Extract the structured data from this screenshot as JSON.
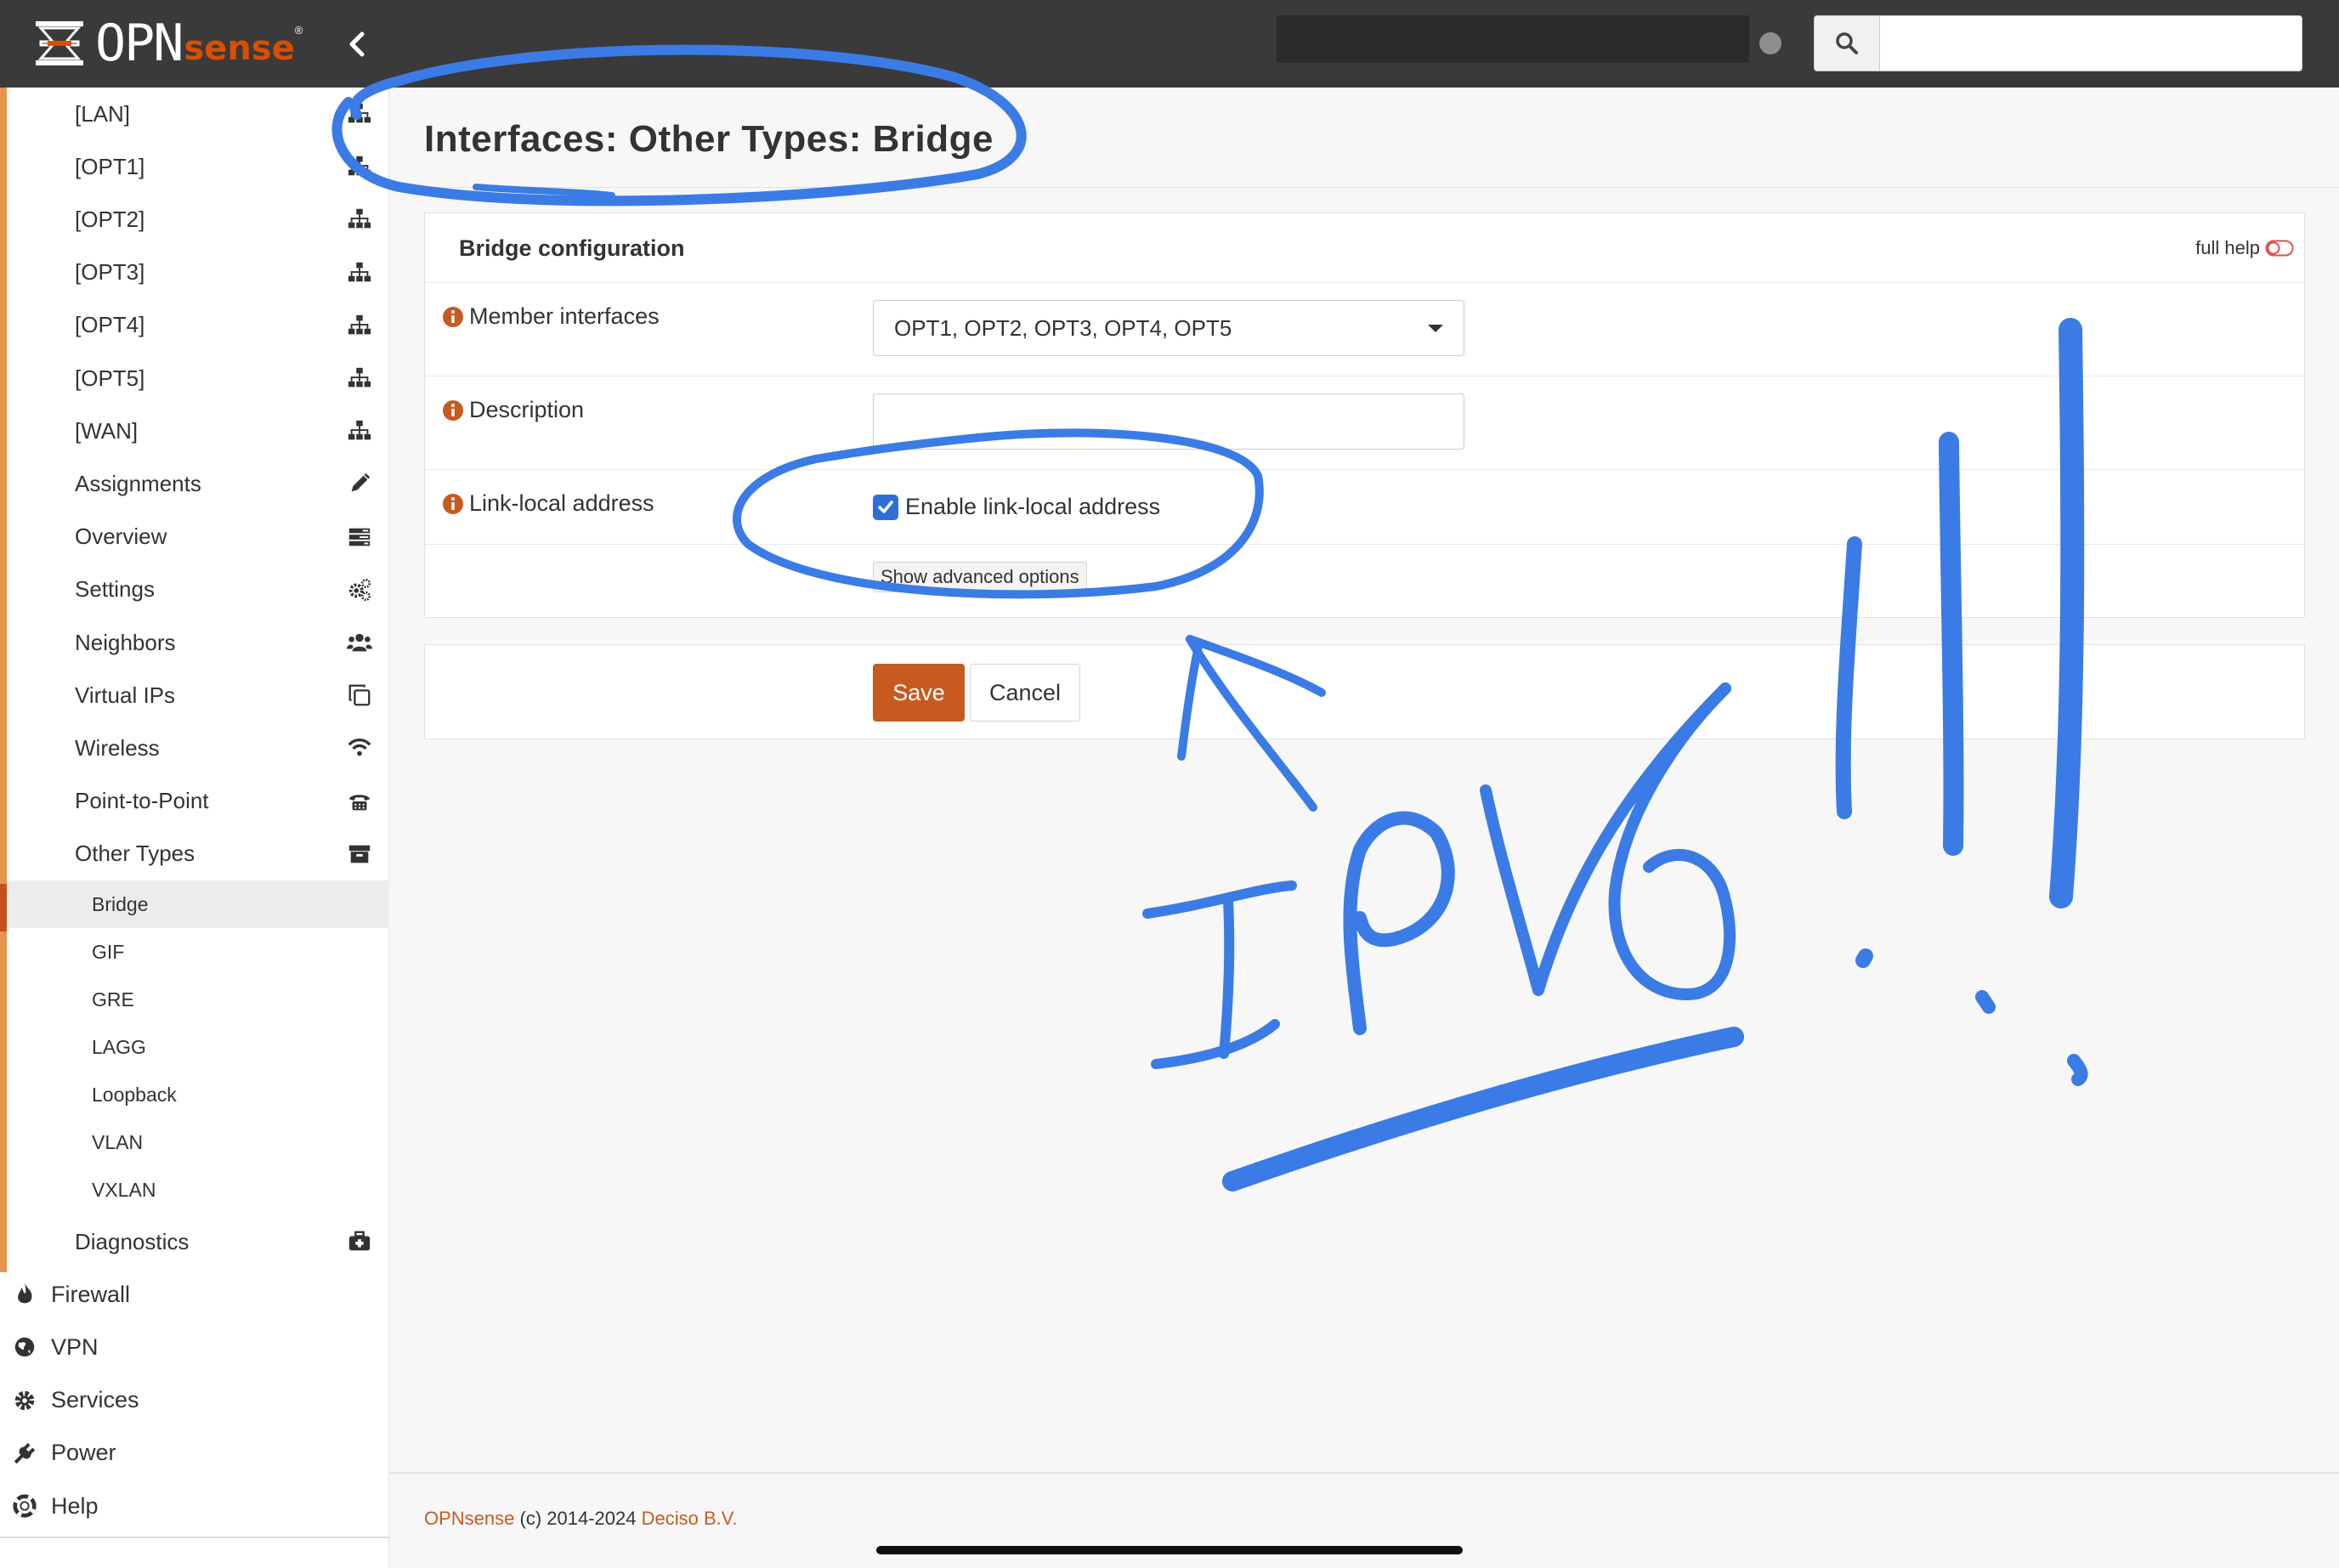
{
  "brand": {
    "opn": "OPN",
    "sense": "sense",
    "reg": "®"
  },
  "search": {
    "placeholder": "",
    "value": ""
  },
  "sidebar": {
    "interfaces": [
      {
        "label": "[LAN]",
        "icon": "sitemap-icon"
      },
      {
        "label": "[OPT1]",
        "icon": "sitemap-icon"
      },
      {
        "label": "[OPT2]",
        "icon": "sitemap-icon"
      },
      {
        "label": "[OPT3]",
        "icon": "sitemap-icon"
      },
      {
        "label": "[OPT4]",
        "icon": "sitemap-icon"
      },
      {
        "label": "[OPT5]",
        "icon": "sitemap-icon"
      },
      {
        "label": "[WAN]",
        "icon": "sitemap-icon"
      },
      {
        "label": "Assignments",
        "icon": "pencil-icon"
      },
      {
        "label": "Overview",
        "icon": "tasks-icon"
      },
      {
        "label": "Settings",
        "icon": "cogs-icon"
      },
      {
        "label": "Neighbors",
        "icon": "users-icon"
      },
      {
        "label": "Virtual IPs",
        "icon": "clone-icon"
      },
      {
        "label": "Wireless",
        "icon": "wifi-icon"
      },
      {
        "label": "Point-to-Point",
        "icon": "phone-icon"
      },
      {
        "label": "Other Types",
        "icon": "archive-icon"
      }
    ],
    "other_types": [
      {
        "label": "Bridge",
        "active": true
      },
      {
        "label": "GIF"
      },
      {
        "label": "GRE"
      },
      {
        "label": "LAGG"
      },
      {
        "label": "Loopback"
      },
      {
        "label": "VLAN"
      },
      {
        "label": "VXLAN"
      }
    ],
    "diagnostics": {
      "label": "Diagnostics",
      "icon": "medkit-icon"
    },
    "top_level": [
      {
        "label": "Firewall",
        "icon": "fire-icon"
      },
      {
        "label": "VPN",
        "icon": "globe-icon"
      },
      {
        "label": "Services",
        "icon": "cog-icon"
      },
      {
        "label": "Power",
        "icon": "plug-icon"
      },
      {
        "label": "Help",
        "icon": "lifebuoy-icon"
      }
    ]
  },
  "page": {
    "title": "Interfaces: Other Types: Bridge"
  },
  "form": {
    "section_title": "Bridge configuration",
    "full_help": "full help",
    "member_interfaces": {
      "label": "Member interfaces",
      "value": "OPT1, OPT2, OPT3, OPT4, OPT5"
    },
    "description": {
      "label": "Description",
      "value": ""
    },
    "link_local": {
      "label": "Link-local address",
      "checkbox_label": "Enable link-local address",
      "checked": true
    },
    "advanced_button": "Show advanced options"
  },
  "actions": {
    "save": "Save",
    "cancel": "Cancel"
  },
  "footer": {
    "brand": "OPNsense",
    "copyright": " (c) 2014-2024 ",
    "company": "Deciso B.V."
  },
  "annotation": {
    "text": "IPV6 !!!",
    "color": "#3b7be6"
  },
  "colors": {
    "accent": "#c75a1f",
    "sidebar_accent": "#e8934c",
    "topbar": "#3a3a3a",
    "checkbox": "#2f6ed9"
  }
}
